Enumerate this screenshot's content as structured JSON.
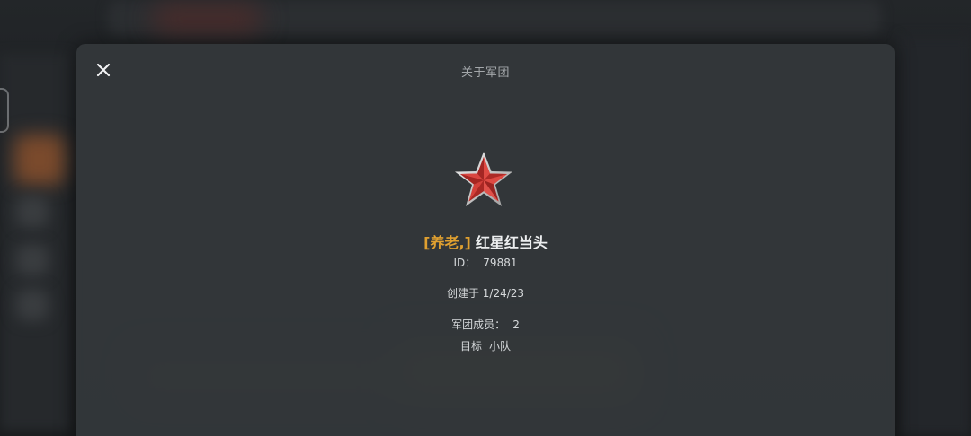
{
  "dialog": {
    "title": "关于军团",
    "close_icon": "close-icon"
  },
  "legion": {
    "emblem_icon": "red-star-icon",
    "tag": "[养老,]",
    "name": "红星红当头",
    "id_label": "ID：",
    "id_value": "79881",
    "created_label": "创建于",
    "created_value": "1/24/23",
    "members_label": "军团成员：",
    "members_value": "2",
    "goal_label": "目标",
    "goal_value": "小队"
  },
  "colors": {
    "tag": "#e0a030",
    "star_red": "#c8322e",
    "star_rim": "#d9d9d9"
  }
}
